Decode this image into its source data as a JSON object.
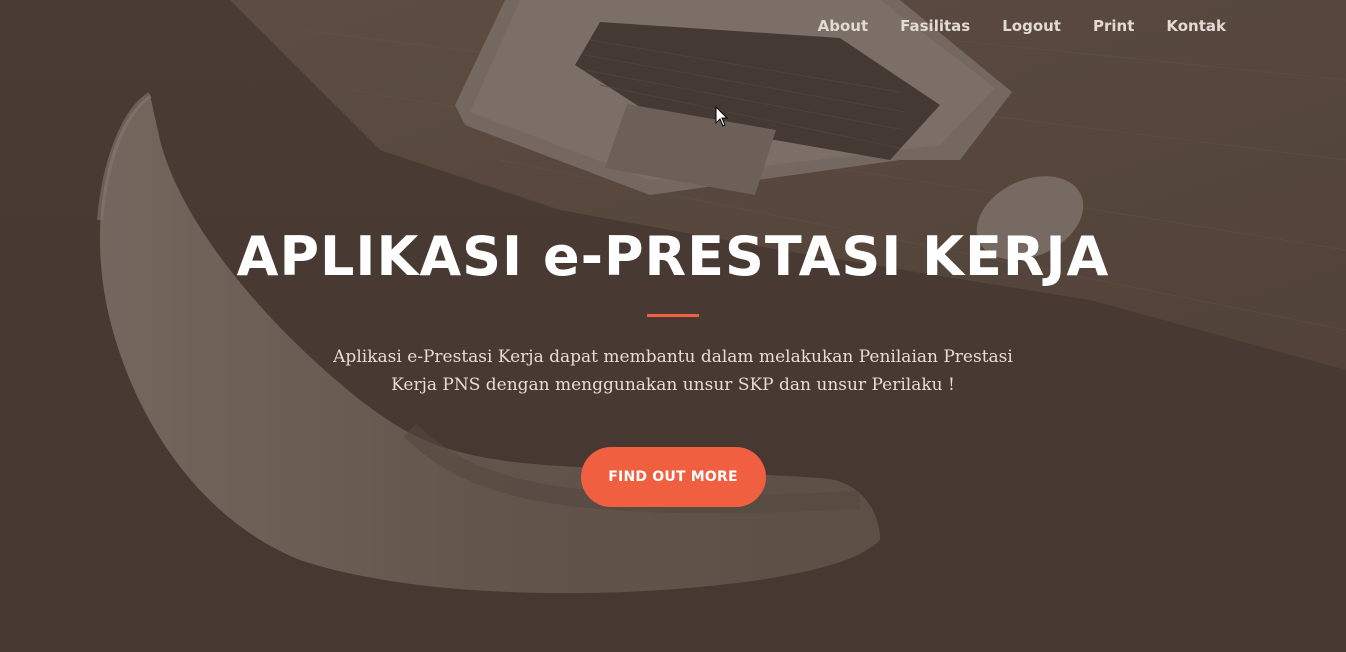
{
  "nav": {
    "items": [
      {
        "label": "About"
      },
      {
        "label": "Fasilitas"
      },
      {
        "label": "Logout"
      },
      {
        "label": "Print"
      },
      {
        "label": "Kontak"
      }
    ]
  },
  "hero": {
    "title": "APLIKASI e-PRESTASI KERJA",
    "subtitle_line1": "Aplikasi e-Prestasi Kerja dapat membantu dalam melakukan Penilaian Prestasi",
    "subtitle_line2": "Kerja PNS dengan menggunakan unsur SKP dan unsur Perilaku !",
    "cta_label": "FIND OUT MORE"
  },
  "colors": {
    "accent": "#f05f40",
    "overlay": "#4e4039",
    "text_light": "#ffffff"
  },
  "icons": {
    "cursor": "mouse-pointer-icon"
  }
}
